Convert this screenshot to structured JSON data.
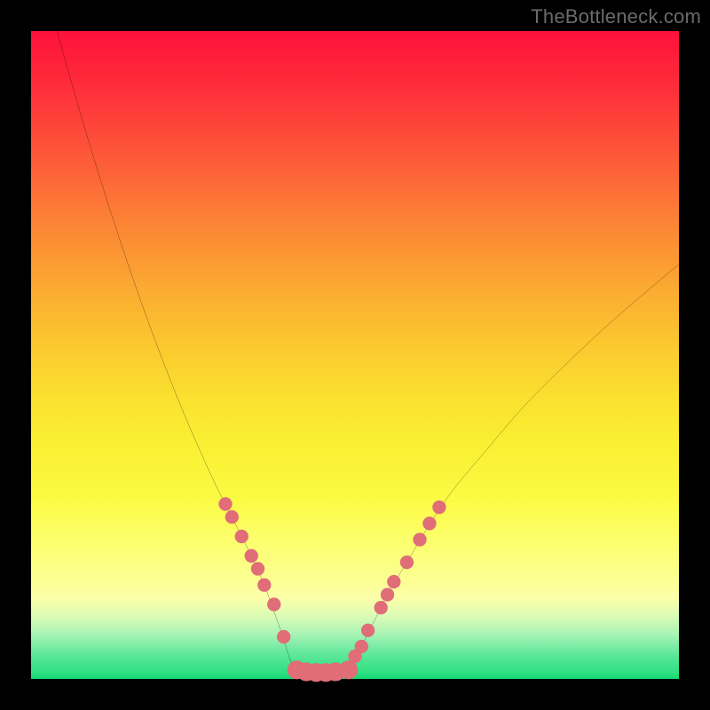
{
  "watermark": "TheBottleneck.com",
  "chart_data": {
    "type": "line",
    "title": "",
    "xlabel": "",
    "ylabel": "",
    "xlim": [
      0,
      100
    ],
    "ylim": [
      0,
      100
    ],
    "grid": false,
    "legend": false,
    "series": [
      {
        "name": "left-curve",
        "x": [
          4,
          8,
          12,
          16,
          20,
          24,
          28,
          30,
          32,
          34,
          36,
          38,
          39,
          40,
          41
        ],
        "y": [
          100,
          86,
          73,
          61,
          50,
          40,
          31,
          27,
          23,
          19,
          14.5,
          9,
          6,
          3,
          1.2
        ]
      },
      {
        "name": "right-curve",
        "x": [
          49,
          50,
          51,
          53,
          55,
          58,
          61,
          65,
          70,
          76,
          83,
          90,
          97,
          100
        ],
        "y": [
          1.2,
          3,
          5,
          9,
          13,
          18,
          23,
          29,
          35,
          42,
          49,
          55.5,
          61.5,
          64
        ]
      },
      {
        "name": "bottom-flat",
        "x": [
          41,
          42,
          43,
          44,
          45,
          46,
          47,
          48,
          49
        ],
        "y": [
          1.2,
          0.9,
          0.8,
          0.8,
          0.8,
          0.8,
          0.8,
          0.9,
          1.2
        ]
      }
    ],
    "points": {
      "name": "highlight-dots",
      "color": "#e06d78",
      "radius_vals": [
        1.05,
        1.05,
        1.05,
        1.05,
        1.05,
        1.05,
        1.05,
        1.05,
        1.45,
        1.45,
        1.45,
        1.45,
        1.45,
        1.45,
        1.05,
        1.05,
        1.05,
        1.05,
        1.05,
        1.05,
        1.05,
        1.05,
        1.05,
        1.05
      ],
      "x": [
        30,
        31,
        32.5,
        34,
        35,
        36,
        37.5,
        39,
        41,
        42.5,
        44,
        45.5,
        47,
        49,
        50,
        51,
        52,
        54,
        55,
        56,
        58,
        60,
        61.5,
        63
      ],
      "y": [
        27,
        25,
        22,
        19,
        17,
        14.5,
        11.5,
        6.5,
        1.4,
        1.1,
        1.0,
        1.0,
        1.1,
        1.4,
        3.5,
        5,
        7.5,
        11,
        13,
        15,
        18,
        21.5,
        24,
        26.5
      ]
    }
  }
}
